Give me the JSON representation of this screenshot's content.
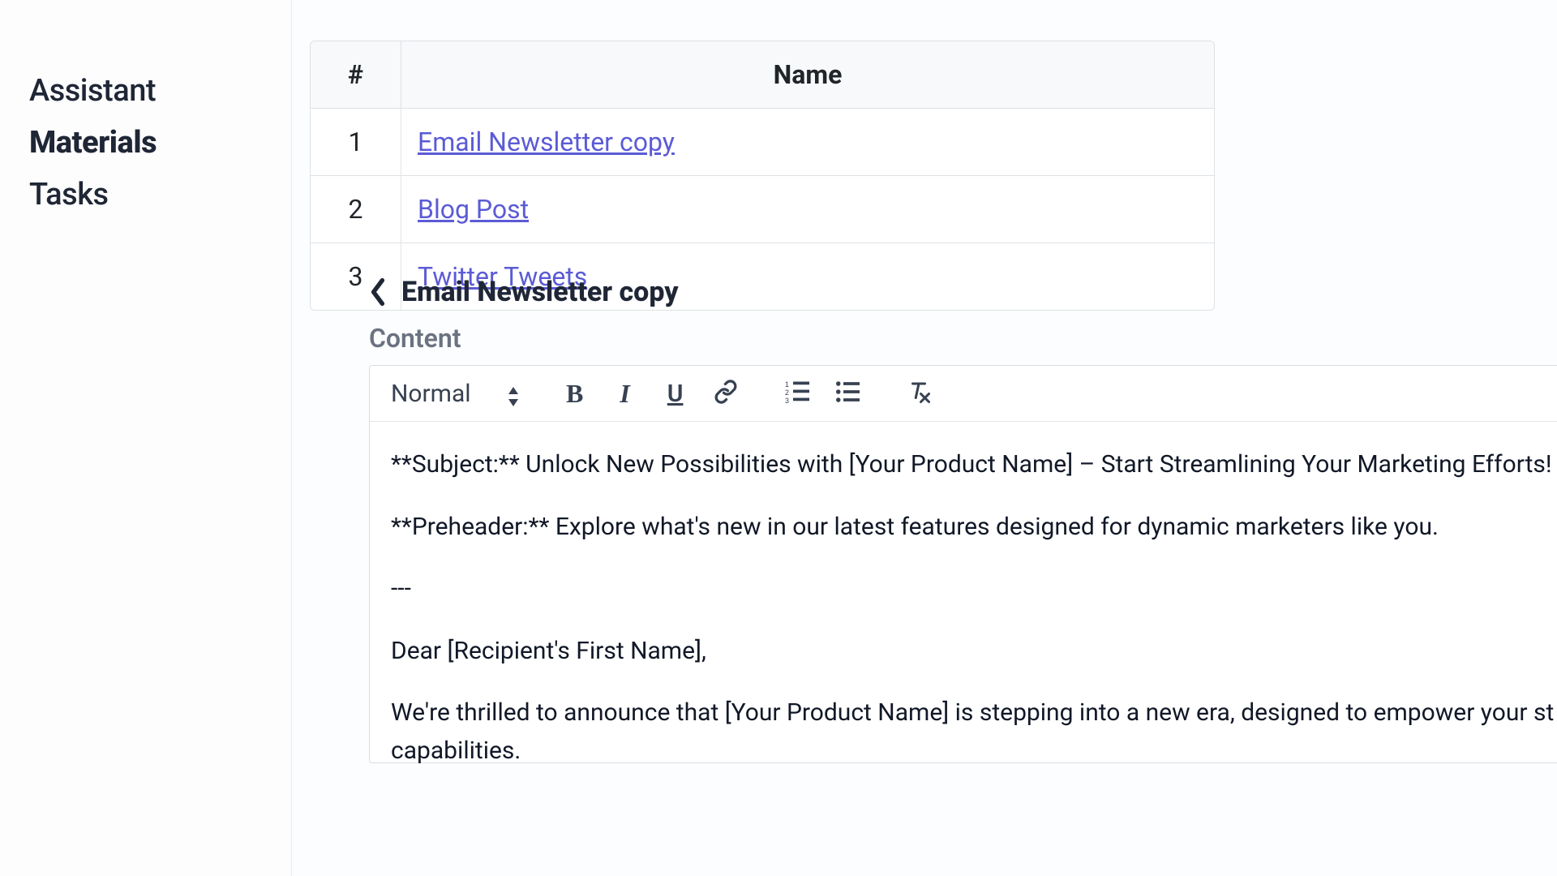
{
  "sidebar": {
    "items": [
      {
        "label": "Assistant",
        "active": false
      },
      {
        "label": "Materials",
        "active": true
      },
      {
        "label": "Tasks",
        "active": false
      }
    ]
  },
  "table": {
    "header_num": "#",
    "header_name": "Name",
    "rows": [
      {
        "num": "1",
        "name": "Email Newsletter copy"
      },
      {
        "num": "2",
        "name": "Blog Post"
      },
      {
        "num": "3",
        "name": "Twitter Tweets"
      }
    ]
  },
  "detail": {
    "title": "Email Newsletter copy",
    "section_label": "Content"
  },
  "editor": {
    "format_label": "Normal",
    "body": {
      "p1": "**Subject:** Unlock New Possibilities with [Your Product Name] – Start Streamlining Your Marketing Efforts!",
      "p2": "**Preheader:** Explore what's new in our latest features designed for dynamic marketers like you.",
      "p3": "---",
      "p4": "Dear [Recipient's First Name],",
      "p5": "We're thrilled to announce that [Your Product Name] is stepping into a new era, designed to empower your st capabilities."
    }
  }
}
